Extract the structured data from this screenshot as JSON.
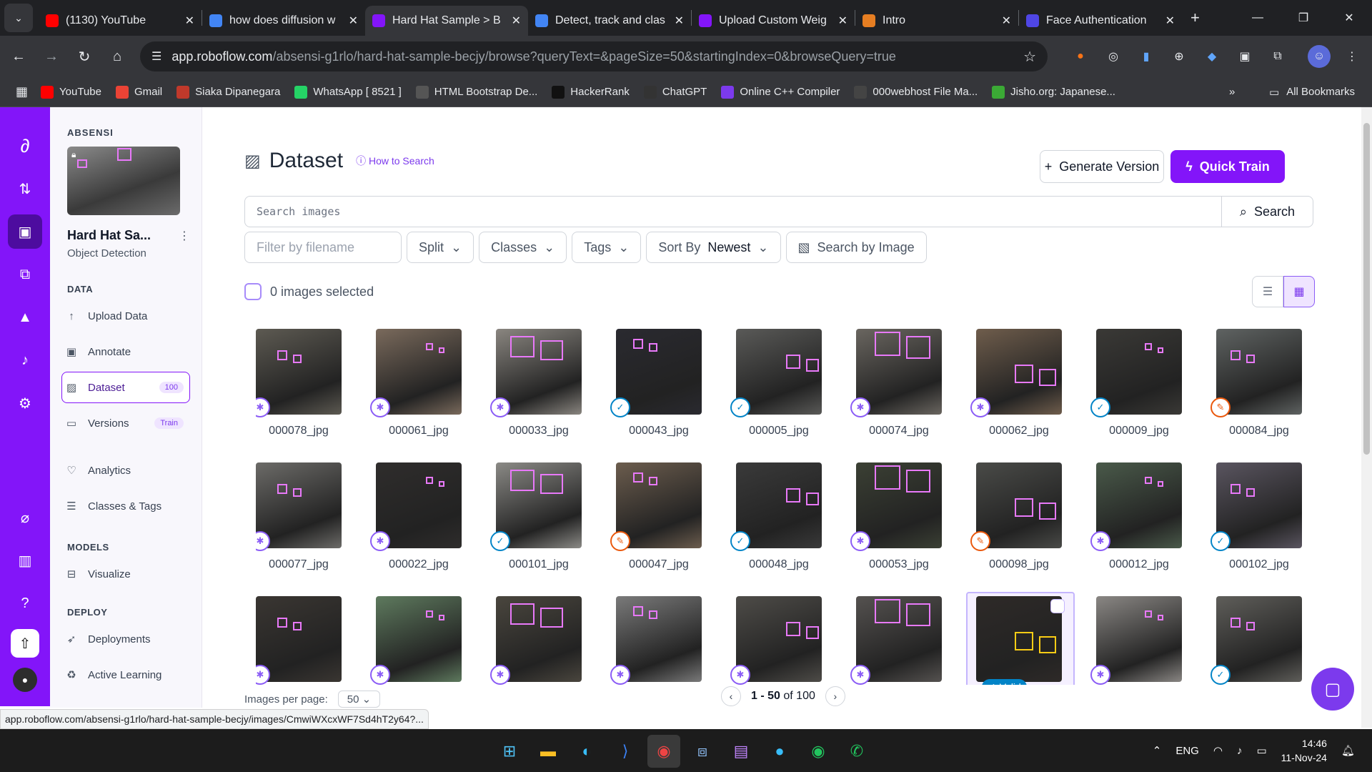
{
  "browser": {
    "tabs": [
      {
        "title": "(1130) YouTube",
        "icon": "youtube-icon",
        "color": "#ff0000",
        "active": false
      },
      {
        "title": "how does diffusion w",
        "icon": "google-icon",
        "color": "#4285f4",
        "active": false
      },
      {
        "title": "Hard Hat Sample > B",
        "icon": "roboflow-icon",
        "color": "#8315f9",
        "active": true
      },
      {
        "title": "Detect, track and clas",
        "icon": "google-icon",
        "color": "#4285f4",
        "active": false
      },
      {
        "title": "Upload Custom Weig",
        "icon": "roboflow-icon",
        "color": "#8315f9",
        "active": false
      },
      {
        "title": "Intro",
        "icon": "notion-icon",
        "color": "#e67e22",
        "active": false
      },
      {
        "title": "Face Authentication",
        "icon": "face-icon",
        "color": "#4f46e5",
        "active": false
      }
    ],
    "url_host": "app.roboflow.com",
    "url_path": "/absensi-g1rlo/hard-hat-sample-becjy/browse?queryText=&pageSize=50&startingIndex=0&browseQuery=true",
    "bookmarks": [
      {
        "label": "YouTube",
        "color": "#ff0000"
      },
      {
        "label": "Gmail",
        "color": "#ea4335"
      },
      {
        "label": "Siaka Dipanegara",
        "color": "#c0392b"
      },
      {
        "label": "WhatsApp [ 8521 ]",
        "color": "#25d366"
      },
      {
        "label": "HTML Bootstrap De...",
        "color": "#555555"
      },
      {
        "label": "HackerRank",
        "color": "#111111"
      },
      {
        "label": "ChatGPT",
        "color": "#333333"
      },
      {
        "label": "Online C++ Compiler",
        "color": "#7c3aed"
      },
      {
        "label": "000webhost File Ma...",
        "color": "#444444"
      },
      {
        "label": "Jisho.org: Japanese...",
        "color": "#3ba935"
      }
    ],
    "all_bookmarks": "All Bookmarks",
    "status_url": "app.roboflow.com/absensi-g1rlo/hard-hat-sample-becjy/images/CmwiWXcxWF7Sd4hT2y64?..."
  },
  "sidebar": {
    "workspace": "ABSENSI",
    "project_name": "Hard Hat Sa...",
    "project_type": "Object Detection",
    "data_header": "DATA",
    "data_items": [
      {
        "label": "Upload Data",
        "icon": "upload-icon"
      },
      {
        "label": "Annotate",
        "icon": "annotate-icon"
      },
      {
        "label": "Dataset",
        "icon": "dataset-icon",
        "badge": "100",
        "active": true
      },
      {
        "label": "Versions",
        "icon": "versions-icon",
        "badge": "Train"
      },
      {
        "label": "Analytics",
        "icon": "analytics-icon"
      },
      {
        "label": "Classes & Tags",
        "icon": "classes-icon"
      }
    ],
    "models_header": "MODELS",
    "models_items": [
      {
        "label": "Visualize",
        "icon": "visualize-icon"
      }
    ],
    "deploy_header": "DEPLOY",
    "deploy_items": [
      {
        "label": "Deployments",
        "icon": "rocket-icon"
      },
      {
        "label": "Active Learning",
        "icon": "recycle-icon"
      }
    ]
  },
  "main": {
    "title": "Dataset",
    "how_to": "How to Search",
    "generate_version": "Generate Version",
    "quick_train": "Quick Train",
    "search_placeholder": "Search images",
    "search_button": "Search",
    "filter_placeholder": "Filter by filename",
    "split": "Split",
    "classes": "Classes",
    "tags": "Tags",
    "sort_by": "Sort By",
    "sort_value": "Newest",
    "search_by_image": "Search by Image",
    "selected": "0 images selected",
    "images_per_page_label": "Images per page:",
    "images_per_page": "50",
    "range": "1 - 50",
    "of": "of 100"
  },
  "images": [
    {
      "name": "000078_jpg",
      "status": "annotated",
      "bg": "#5d5a52"
    },
    {
      "name": "000061_jpg",
      "status": "annotated",
      "bg": "#7a6a5c"
    },
    {
      "name": "000033_jpg",
      "status": "annotated",
      "bg": "#8a8680"
    },
    {
      "name": "000043_jpg",
      "status": "valid",
      "bg": "#2a2a30"
    },
    {
      "name": "000005_jpg",
      "status": "valid",
      "bg": "#5a5a58"
    },
    {
      "name": "000074_jpg",
      "status": "annotated",
      "bg": "#6a6660"
    },
    {
      "name": "000062_jpg",
      "status": "annotated",
      "bg": "#6f5d4c"
    },
    {
      "name": "000009_jpg",
      "status": "valid",
      "bg": "#3a3936"
    },
    {
      "name": "000084_jpg",
      "status": "edit",
      "bg": "#5f6362"
    },
    {
      "name": "000077_jpg",
      "status": "annotated",
      "bg": "#6c6b68"
    },
    {
      "name": "000022_jpg",
      "status": "annotated",
      "bg": "#2f2d2c"
    },
    {
      "name": "000101_jpg",
      "status": "valid",
      "bg": "#8b8a86"
    },
    {
      "name": "000047_jpg",
      "status": "edit",
      "bg": "#6c5d4e"
    },
    {
      "name": "000048_jpg",
      "status": "valid",
      "bg": "#3a3a3a"
    },
    {
      "name": "000053_jpg",
      "status": "annotated",
      "bg": "#3b4034"
    },
    {
      "name": "000098_jpg",
      "status": "edit",
      "bg": "#4a4b48"
    },
    {
      "name": "000012_jpg",
      "status": "annotated",
      "bg": "#4a5a4a"
    },
    {
      "name": "000102_jpg",
      "status": "valid",
      "bg": "#5a5560"
    },
    {
      "name": "",
      "status": "annotated",
      "bg": "#3a3632"
    },
    {
      "name": "",
      "status": "annotated",
      "bg": "#5e7a5e"
    },
    {
      "name": "",
      "status": "annotated",
      "bg": "#4a463e"
    },
    {
      "name": "",
      "status": "annotated",
      "bg": "#7a7a7a"
    },
    {
      "name": "",
      "status": "annotated",
      "bg": "#4e4c48"
    },
    {
      "name": "",
      "status": "annotated",
      "bg": "#555250"
    },
    {
      "name": "",
      "status": "valid",
      "bg": "#2e2a28",
      "label": "Valid"
    },
    {
      "name": "",
      "status": "annotated",
      "bg": "#8a8784"
    },
    {
      "name": "",
      "status": "valid",
      "bg": "#5f5e5a"
    }
  ],
  "taskbar": {
    "lang": "ENG",
    "time": "14:46",
    "date": "11-Nov-24"
  }
}
